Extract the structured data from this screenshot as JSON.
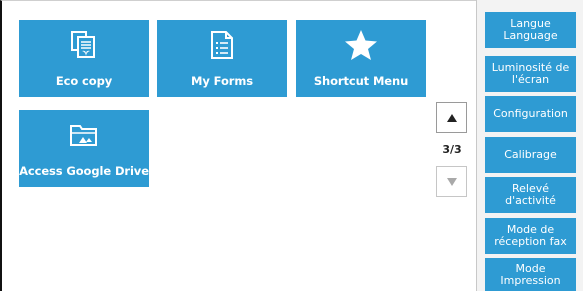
{
  "tiles": [
    {
      "label": "Eco copy",
      "icon": "eco-copy-icon"
    },
    {
      "label": "My Forms",
      "icon": "forms-icon"
    },
    {
      "label": "Shortcut Menu",
      "icon": "star-icon"
    },
    {
      "label": "Access Google Drive",
      "icon": "folder-icon"
    }
  ],
  "pager": {
    "indicator": "3/3",
    "up_icon": "arrow-up-icon",
    "down_icon": "arrow-down-icon"
  },
  "sidebar": {
    "items": [
      {
        "label": "Langue\nLanguage"
      },
      {
        "label": "Luminosité de\nl'écran"
      },
      {
        "label": "Configuration"
      },
      {
        "label": "Calibrage"
      },
      {
        "label": "Relevé\nd'activité"
      },
      {
        "label": "Mode de\nréception fax"
      },
      {
        "label": "Mode\nImpression"
      }
    ]
  },
  "colors": {
    "tile": "#2e9bd3",
    "sidebar_bg": "#f3f3f3"
  }
}
